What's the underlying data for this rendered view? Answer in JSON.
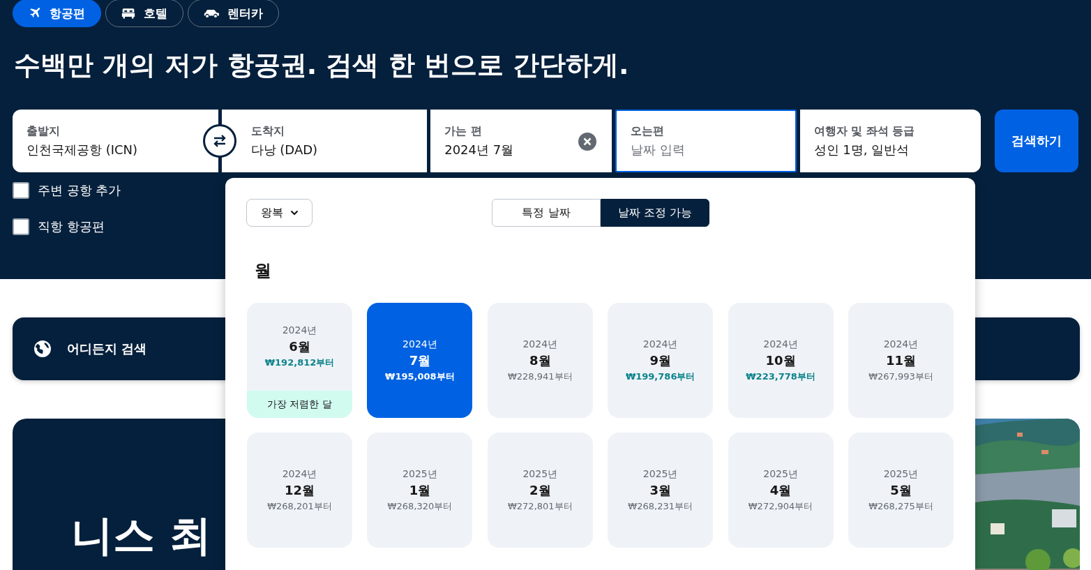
{
  "tabs": [
    {
      "label": "항공편",
      "kind": "flight",
      "selected": true
    },
    {
      "label": "호텔",
      "kind": "hotel",
      "selected": false
    },
    {
      "label": "렌터카",
      "kind": "car",
      "selected": false
    }
  ],
  "headline": "수백만 개의 저가 항공권. 검색 한 번으로 간단하게.",
  "search": {
    "fields": [
      {
        "label": "출발지",
        "value": "인천국제공항 (ICN)",
        "focused": false
      },
      {
        "label": "도착지",
        "value": "다낭 (DAD)",
        "focused": false
      },
      {
        "label": "가는 편",
        "value": "2024년 7월",
        "focused": false,
        "clearable": true
      },
      {
        "label": "오는편",
        "placeholder": "날짜 입력",
        "focused": true
      },
      {
        "label": "여행자 및 좌석 등급",
        "value": "성인 1명, 일반석",
        "focused": false
      }
    ],
    "button": "검색하기"
  },
  "options": [
    {
      "label": "주변 공항 추가",
      "checked": false
    },
    {
      "label": "직항 항공편",
      "checked": false
    }
  ],
  "explore": {
    "label": "어디든지 검색"
  },
  "promo": {
    "title": "니스 최"
  },
  "date_picker": {
    "trip_type": "왕복",
    "modes": [
      {
        "label": "특정 날짜",
        "selected": false
      },
      {
        "label": "날짜 조정 가능",
        "selected": true
      }
    ],
    "section_title": "월",
    "months": [
      {
        "year": "2024년",
        "month": "6월",
        "price": "₩192,812부터",
        "price_highlight": true,
        "selected": false,
        "badge": "가장 저렴한 달"
      },
      {
        "year": "2024년",
        "month": "7월",
        "price": "₩195,008부터",
        "price_highlight": true,
        "selected": true
      },
      {
        "year": "2024년",
        "month": "8월",
        "price": "₩228,941부터",
        "price_highlight": false,
        "selected": false
      },
      {
        "year": "2024년",
        "month": "9월",
        "price": "₩199,786부터",
        "price_highlight": true,
        "selected": false
      },
      {
        "year": "2024년",
        "month": "10월",
        "price": "₩223,778부터",
        "price_highlight": true,
        "selected": false
      },
      {
        "year": "2024년",
        "month": "11월",
        "price": "₩267,993부터",
        "price_highlight": false,
        "selected": false
      },
      {
        "year": "2024년",
        "month": "12월",
        "price": "₩268,201부터",
        "price_highlight": false,
        "selected": false
      },
      {
        "year": "2025년",
        "month": "1월",
        "price": "₩268,320부터",
        "price_highlight": false,
        "selected": false
      },
      {
        "year": "2025년",
        "month": "2월",
        "price": "₩272,801부터",
        "price_highlight": false,
        "selected": false
      },
      {
        "year": "2025년",
        "month": "3월",
        "price": "₩268,231부터",
        "price_highlight": false,
        "selected": false
      },
      {
        "year": "2025년",
        "month": "4월",
        "price": "₩272,904부터",
        "price_highlight": false,
        "selected": false
      },
      {
        "year": "2025년",
        "month": "5월",
        "price": "₩268,275부터",
        "price_highlight": false,
        "selected": false
      }
    ]
  }
}
